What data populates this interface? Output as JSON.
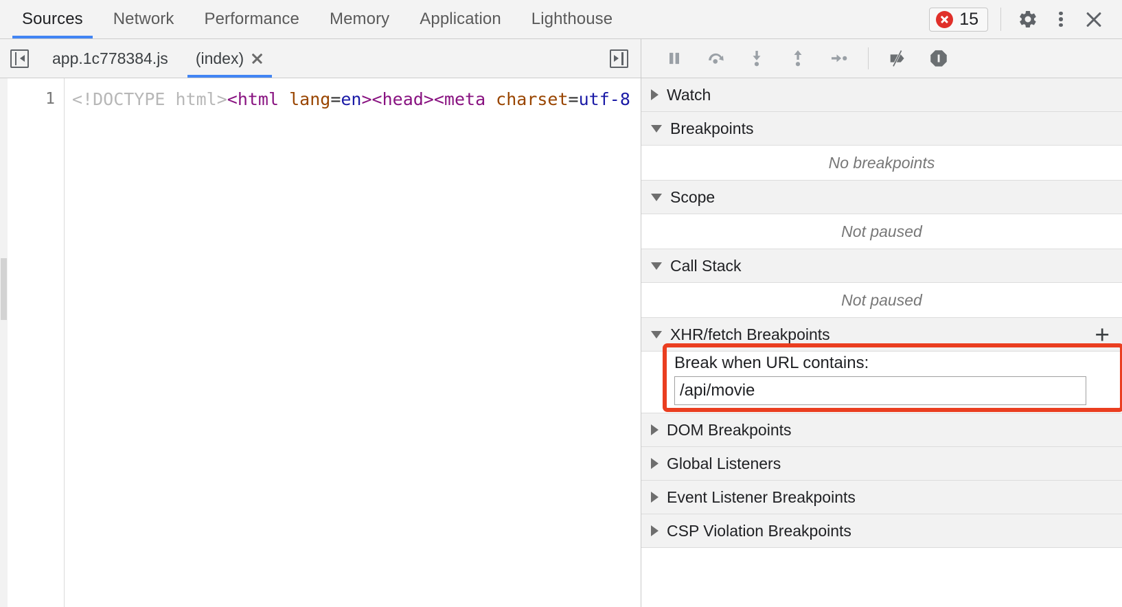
{
  "top_tabs": {
    "items": [
      {
        "label": "Sources",
        "selected": true
      },
      {
        "label": "Network",
        "selected": false
      },
      {
        "label": "Performance",
        "selected": false
      },
      {
        "label": "Memory",
        "selected": false
      },
      {
        "label": "Application",
        "selected": false
      },
      {
        "label": "Lighthouse",
        "selected": false
      }
    ],
    "error_count": "15",
    "error_icon": "error-circle-icon",
    "settings_icon": "gear-icon",
    "more_icon": "kebab-menu-icon",
    "close_icon": "close-icon",
    "accent_color": "#4285f4",
    "error_color": "#e0302a"
  },
  "file_tabs": {
    "nav_toggle_icon": "show-navigator-icon",
    "items": [
      {
        "label": "app.1c778384.js",
        "selected": false,
        "closable": false
      },
      {
        "label": "(index)",
        "selected": true,
        "closable": true
      }
    ],
    "close_icon": "tab-close-icon",
    "expand_icon": "show-debugger-sidebar-icon"
  },
  "editor": {
    "line_number": "1",
    "code_tokens": [
      {
        "text": "<!DOCTYPE html>",
        "type": "doctype"
      },
      {
        "text": "<html",
        "type": "tag"
      },
      {
        "text": " lang",
        "type": "attr"
      },
      {
        "text": "=",
        "type": "plain"
      },
      {
        "text": "en",
        "type": "val"
      },
      {
        "text": ">",
        "type": "tag"
      },
      {
        "text": "<head>",
        "type": "tag"
      },
      {
        "text": "<meta",
        "type": "tag"
      },
      {
        "text": " charset",
        "type": "attr"
      },
      {
        "text": "=",
        "type": "plain"
      },
      {
        "text": "utf-8",
        "type": "val"
      }
    ]
  },
  "debugger_toolbar": {
    "buttons": [
      {
        "name": "pause-resume-button",
        "icon": "pause-icon"
      },
      {
        "name": "step-over-button",
        "icon": "step-over-icon"
      },
      {
        "name": "step-into-button",
        "icon": "step-into-icon"
      },
      {
        "name": "step-out-button",
        "icon": "step-out-icon"
      },
      {
        "name": "step-button",
        "icon": "step-icon"
      },
      {
        "name": "deactivate-breakpoints-button",
        "icon": "deactivate-breakpoints-icon"
      },
      {
        "name": "pause-on-exceptions-button",
        "icon": "pause-on-exceptions-icon"
      }
    ]
  },
  "sidebar": {
    "watch": {
      "title": "Watch",
      "expanded": false
    },
    "breakpoints": {
      "title": "Breakpoints",
      "expanded": true,
      "empty_text": "No breakpoints"
    },
    "scope": {
      "title": "Scope",
      "expanded": true,
      "empty_text": "Not paused"
    },
    "call_stack": {
      "title": "Call Stack",
      "expanded": true,
      "empty_text": "Not paused"
    },
    "xhr_breakpoints": {
      "title": "XHR/fetch Breakpoints",
      "expanded": true,
      "add_label": "+",
      "prompt_label": "Break when URL contains:",
      "input_value": "/api/movie",
      "input_placeholder": "",
      "highlight_color": "#ea3e20"
    },
    "dom_breakpoints": {
      "title": "DOM Breakpoints",
      "expanded": false
    },
    "global_listeners": {
      "title": "Global Listeners",
      "expanded": false
    },
    "event_listener_breakpoints": {
      "title": "Event Listener Breakpoints",
      "expanded": false
    },
    "csp_violation_breakpoints": {
      "title": "CSP Violation Breakpoints",
      "expanded": false
    }
  }
}
